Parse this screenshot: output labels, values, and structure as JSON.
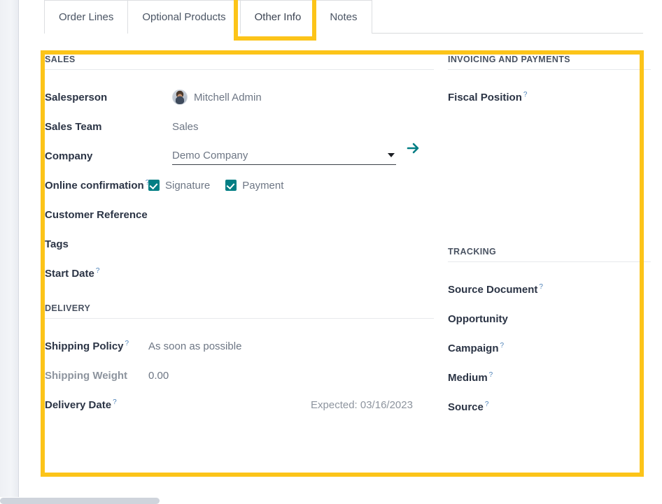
{
  "notebook": {
    "tabs": [
      {
        "label": "Order Lines",
        "active": false
      },
      {
        "label": "Optional Products",
        "active": false
      },
      {
        "label": "Other Info",
        "active": true
      },
      {
        "label": "Notes",
        "active": false
      }
    ]
  },
  "highlight_color": "#fcc419",
  "accent_color": "#017e84",
  "link_color": "#4d82b8",
  "groups": {
    "sales": {
      "title": "Sales",
      "fields": {
        "salesperson": {
          "label": "Salesperson",
          "value": "Mitchell Admin",
          "avatar": "user-avatar"
        },
        "sales_team": {
          "label": "Sales Team",
          "value": "Sales"
        },
        "company": {
          "label": "Company",
          "value": "Demo Company",
          "dropdown_icon": "chevron-down-icon",
          "internal_link_icon": "arrow-right-icon"
        },
        "online_confirmation": {
          "label": "Online confirmation",
          "help": "?",
          "options": [
            {
              "label": "Signature",
              "checked": true
            },
            {
              "label": "Payment",
              "checked": true
            }
          ]
        },
        "customer_reference": {
          "label": "Customer Reference",
          "value": ""
        },
        "tags": {
          "label": "Tags",
          "value": ""
        },
        "start_date": {
          "label": "Start Date",
          "help": "?",
          "value": ""
        }
      }
    },
    "delivery": {
      "title": "Delivery",
      "fields": {
        "shipping_policy": {
          "label": "Shipping Policy",
          "help": "?",
          "value": "As soon as possible"
        },
        "shipping_weight": {
          "label": "Shipping Weight",
          "value": "0.00"
        },
        "delivery_date": {
          "label": "Delivery Date",
          "help": "?",
          "value": "",
          "hint": "Expected: 03/16/2023"
        }
      }
    },
    "invoicing": {
      "title": "Invoicing and Payments",
      "fields": {
        "fiscal_position": {
          "label": "Fiscal Position",
          "help": "?",
          "value": ""
        }
      }
    },
    "tracking": {
      "title": "Tracking",
      "fields": {
        "source_document": {
          "label": "Source Document",
          "help": "?",
          "value": ""
        },
        "opportunity": {
          "label": "Opportunity",
          "value": ""
        },
        "campaign": {
          "label": "Campaign",
          "help": "?",
          "value": ""
        },
        "medium": {
          "label": "Medium",
          "help": "?",
          "value": ""
        },
        "source": {
          "label": "Source",
          "help": "?",
          "value": ""
        }
      }
    }
  }
}
